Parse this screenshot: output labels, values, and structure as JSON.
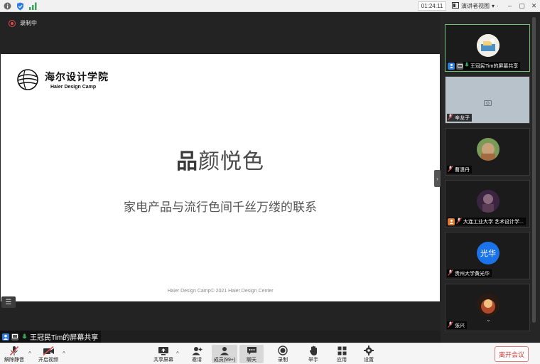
{
  "topbar": {
    "timer": "01:24:11",
    "view_mode": "演讲者视图"
  },
  "recording": {
    "label": "录制中"
  },
  "slide": {
    "logo_cn": "海尔设计学院",
    "logo_en": "Haier Design Camp",
    "title_bold": "品",
    "title_rest": "颜悦色",
    "subtitle": "家电产品与流行色间千丝万缕的联系",
    "footer": "Haier Design Camp© 2021 Haier Design Center"
  },
  "share_label": "王冠民Tim的屏幕共享",
  "participants": [
    {
      "name": "王冠民Tim的屏幕共享",
      "active": true,
      "avatar": "photo-sky"
    },
    {
      "name": "辛龙子",
      "active": false,
      "avatar": "video-off"
    },
    {
      "name": "曹潇丹",
      "active": false,
      "avatar": "photo-person"
    },
    {
      "name": "大连工业大学 艺术设计学...",
      "active": false,
      "avatar": "photo-dark"
    },
    {
      "name": "贵州大学黄光华",
      "active": false,
      "avatar": "initials",
      "initials": "光华"
    },
    {
      "name": "张兴",
      "active": false,
      "avatar": "photo-glow"
    }
  ],
  "toolbar": {
    "mute": "解除静音",
    "video": "开启视频",
    "share": "共享屏幕",
    "invite": "邀请",
    "members": "成员(99+)",
    "chat": "聊天",
    "record": "录制",
    "raise_hand": "举手",
    "apps": "应用",
    "settings": "设置",
    "leave": "离开会议"
  },
  "colors": {
    "accent_green": "#6fbf73",
    "record_red": "#e04a4a",
    "avatar_blue": "#1a73e8",
    "leave_red": "#d23b3b"
  }
}
